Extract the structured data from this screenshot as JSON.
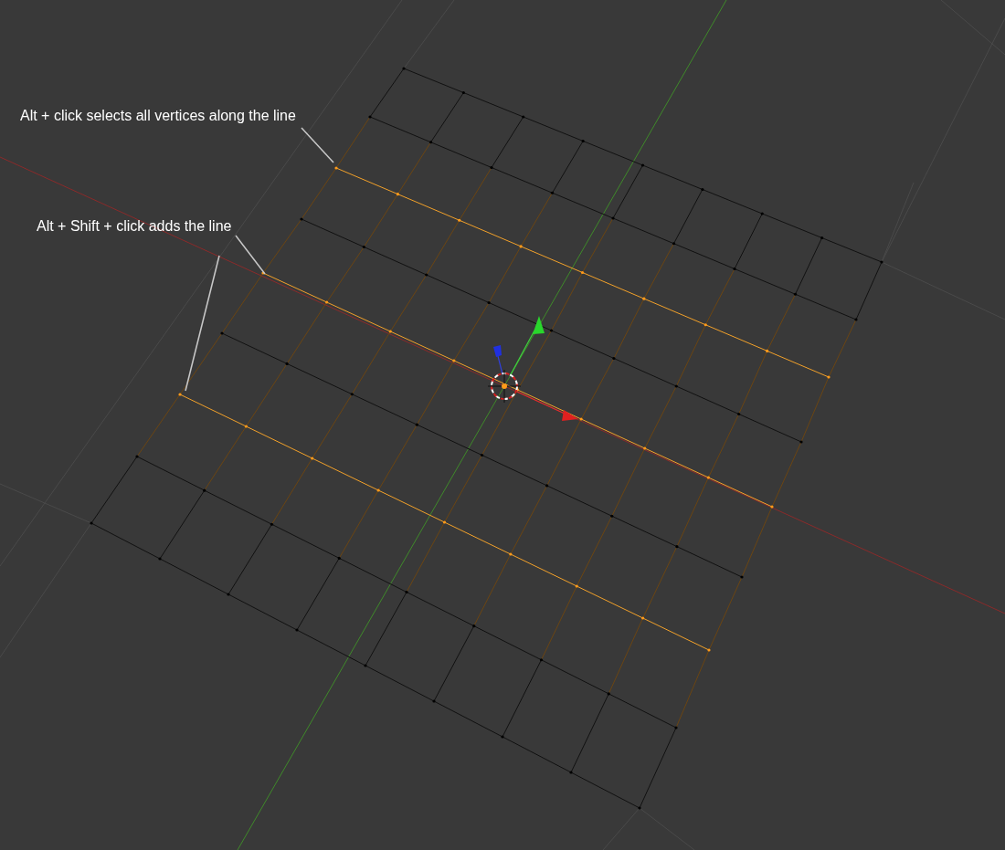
{
  "annotations": [
    {
      "text": "Alt + click selects all vertices along the line"
    },
    {
      "text": "Alt + Shift + click adds the line"
    }
  ],
  "edge_loops": [
    {
      "selected": false
    },
    {
      "selected": false
    },
    {
      "selected": true
    },
    {
      "selected": false
    },
    {
      "selected": true
    },
    {
      "selected": false
    },
    {
      "selected": true
    },
    {
      "selected": false
    },
    {
      "selected": false
    }
  ]
}
